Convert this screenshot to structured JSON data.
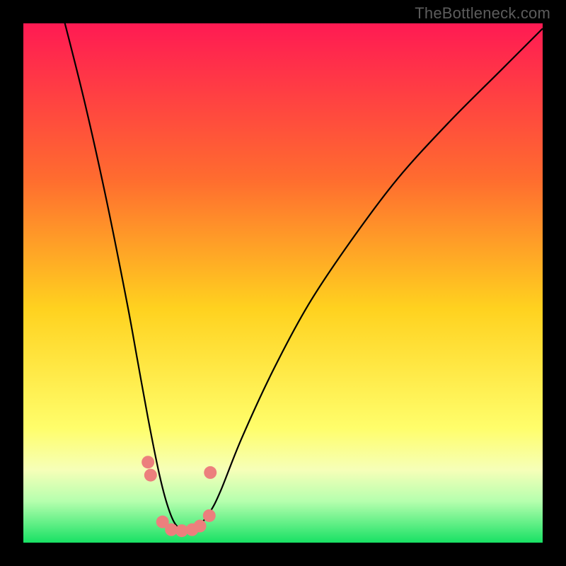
{
  "watermark": "TheBottleneck.com",
  "chart_data": {
    "type": "line",
    "title": "",
    "xlabel": "",
    "ylabel": "",
    "xlim": [
      0,
      100
    ],
    "ylim": [
      0,
      100
    ],
    "grid": false,
    "legend": false,
    "gradient_stops": [
      {
        "offset": 0,
        "color": "#ff1a53"
      },
      {
        "offset": 30,
        "color": "#ff6c2f"
      },
      {
        "offset": 55,
        "color": "#ffd21f"
      },
      {
        "offset": 78,
        "color": "#fffe6b"
      },
      {
        "offset": 86,
        "color": "#f6ffb8"
      },
      {
        "offset": 92,
        "color": "#b6ffae"
      },
      {
        "offset": 100,
        "color": "#18e164"
      }
    ],
    "series": [
      {
        "name": "bottleneck-curve",
        "color": "#000000",
        "x": [
          0,
          4,
          8,
          12,
          16,
          20,
          22,
          24,
          26,
          27.5,
          29,
          30.5,
          32,
          34,
          36,
          38,
          42,
          48,
          55,
          63,
          72,
          82,
          92,
          100
        ],
        "y": [
          128,
          115,
          100,
          84,
          66,
          46,
          35,
          24,
          14,
          8,
          4,
          2.5,
          2.5,
          3.5,
          6,
          10,
          20,
          33,
          46,
          58,
          70,
          81,
          91,
          99
        ]
      }
    ],
    "markers": {
      "name": "highlight-dots",
      "color": "#ec7f7d",
      "radius_px": 9,
      "points": [
        {
          "x": 24.0,
          "y": 15.5
        },
        {
          "x": 24.5,
          "y": 13.0
        },
        {
          "x": 26.8,
          "y": 4.0
        },
        {
          "x": 28.5,
          "y": 2.5
        },
        {
          "x": 30.5,
          "y": 2.3
        },
        {
          "x": 32.5,
          "y": 2.5
        },
        {
          "x": 34.0,
          "y": 3.2
        },
        {
          "x": 35.8,
          "y": 5.2
        },
        {
          "x": 36.0,
          "y": 13.5
        }
      ]
    }
  }
}
